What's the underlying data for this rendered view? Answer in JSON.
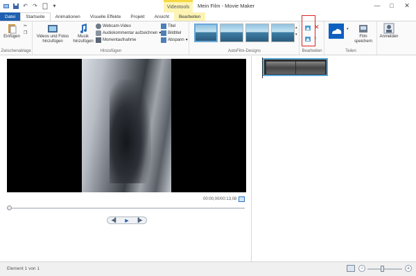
{
  "window": {
    "title": "Mein Film - Movie Maker",
    "context_tab": "Videotools",
    "controls": [
      "—",
      "□",
      "✕"
    ]
  },
  "tabs": [
    {
      "label": "Datei"
    },
    {
      "label": "Startseite"
    },
    {
      "label": "Animationen"
    },
    {
      "label": "Visuelle Effekte"
    },
    {
      "label": "Projekt"
    },
    {
      "label": "Ansicht"
    },
    {
      "label": "Bearbeiten"
    }
  ],
  "ribbon": {
    "clipboard": {
      "paste": "Einfügen",
      "group": "Zwischenablage"
    },
    "add": {
      "videos_photos": "Videos und Fotos hinzufügen",
      "music": "Musik hinzufügen",
      "webcam": "Webcam-Video",
      "narration": "Audiokommentar aufzeichnen",
      "snapshot": "Momentaufnahme",
      "title": "Titel",
      "caption": "Bildtitel",
      "credits": "Abspann",
      "group": "Hinzufügen"
    },
    "autofilm": {
      "group": "AutoFilm-Designs"
    },
    "edit": {
      "group": "Bearbeiten"
    },
    "share": {
      "save_movie": "Film speichern",
      "group": "Teilen"
    },
    "signin": "Anmelden"
  },
  "player": {
    "timecode": "00:00,00/00:13,08"
  },
  "status": {
    "element": "Element 1 von 1"
  },
  "colors": {
    "file_tab": "#1e5fb0",
    "context_tab": "#fdf4b4",
    "highlight": "#e02020",
    "clip_border": "#5aa7d8"
  }
}
